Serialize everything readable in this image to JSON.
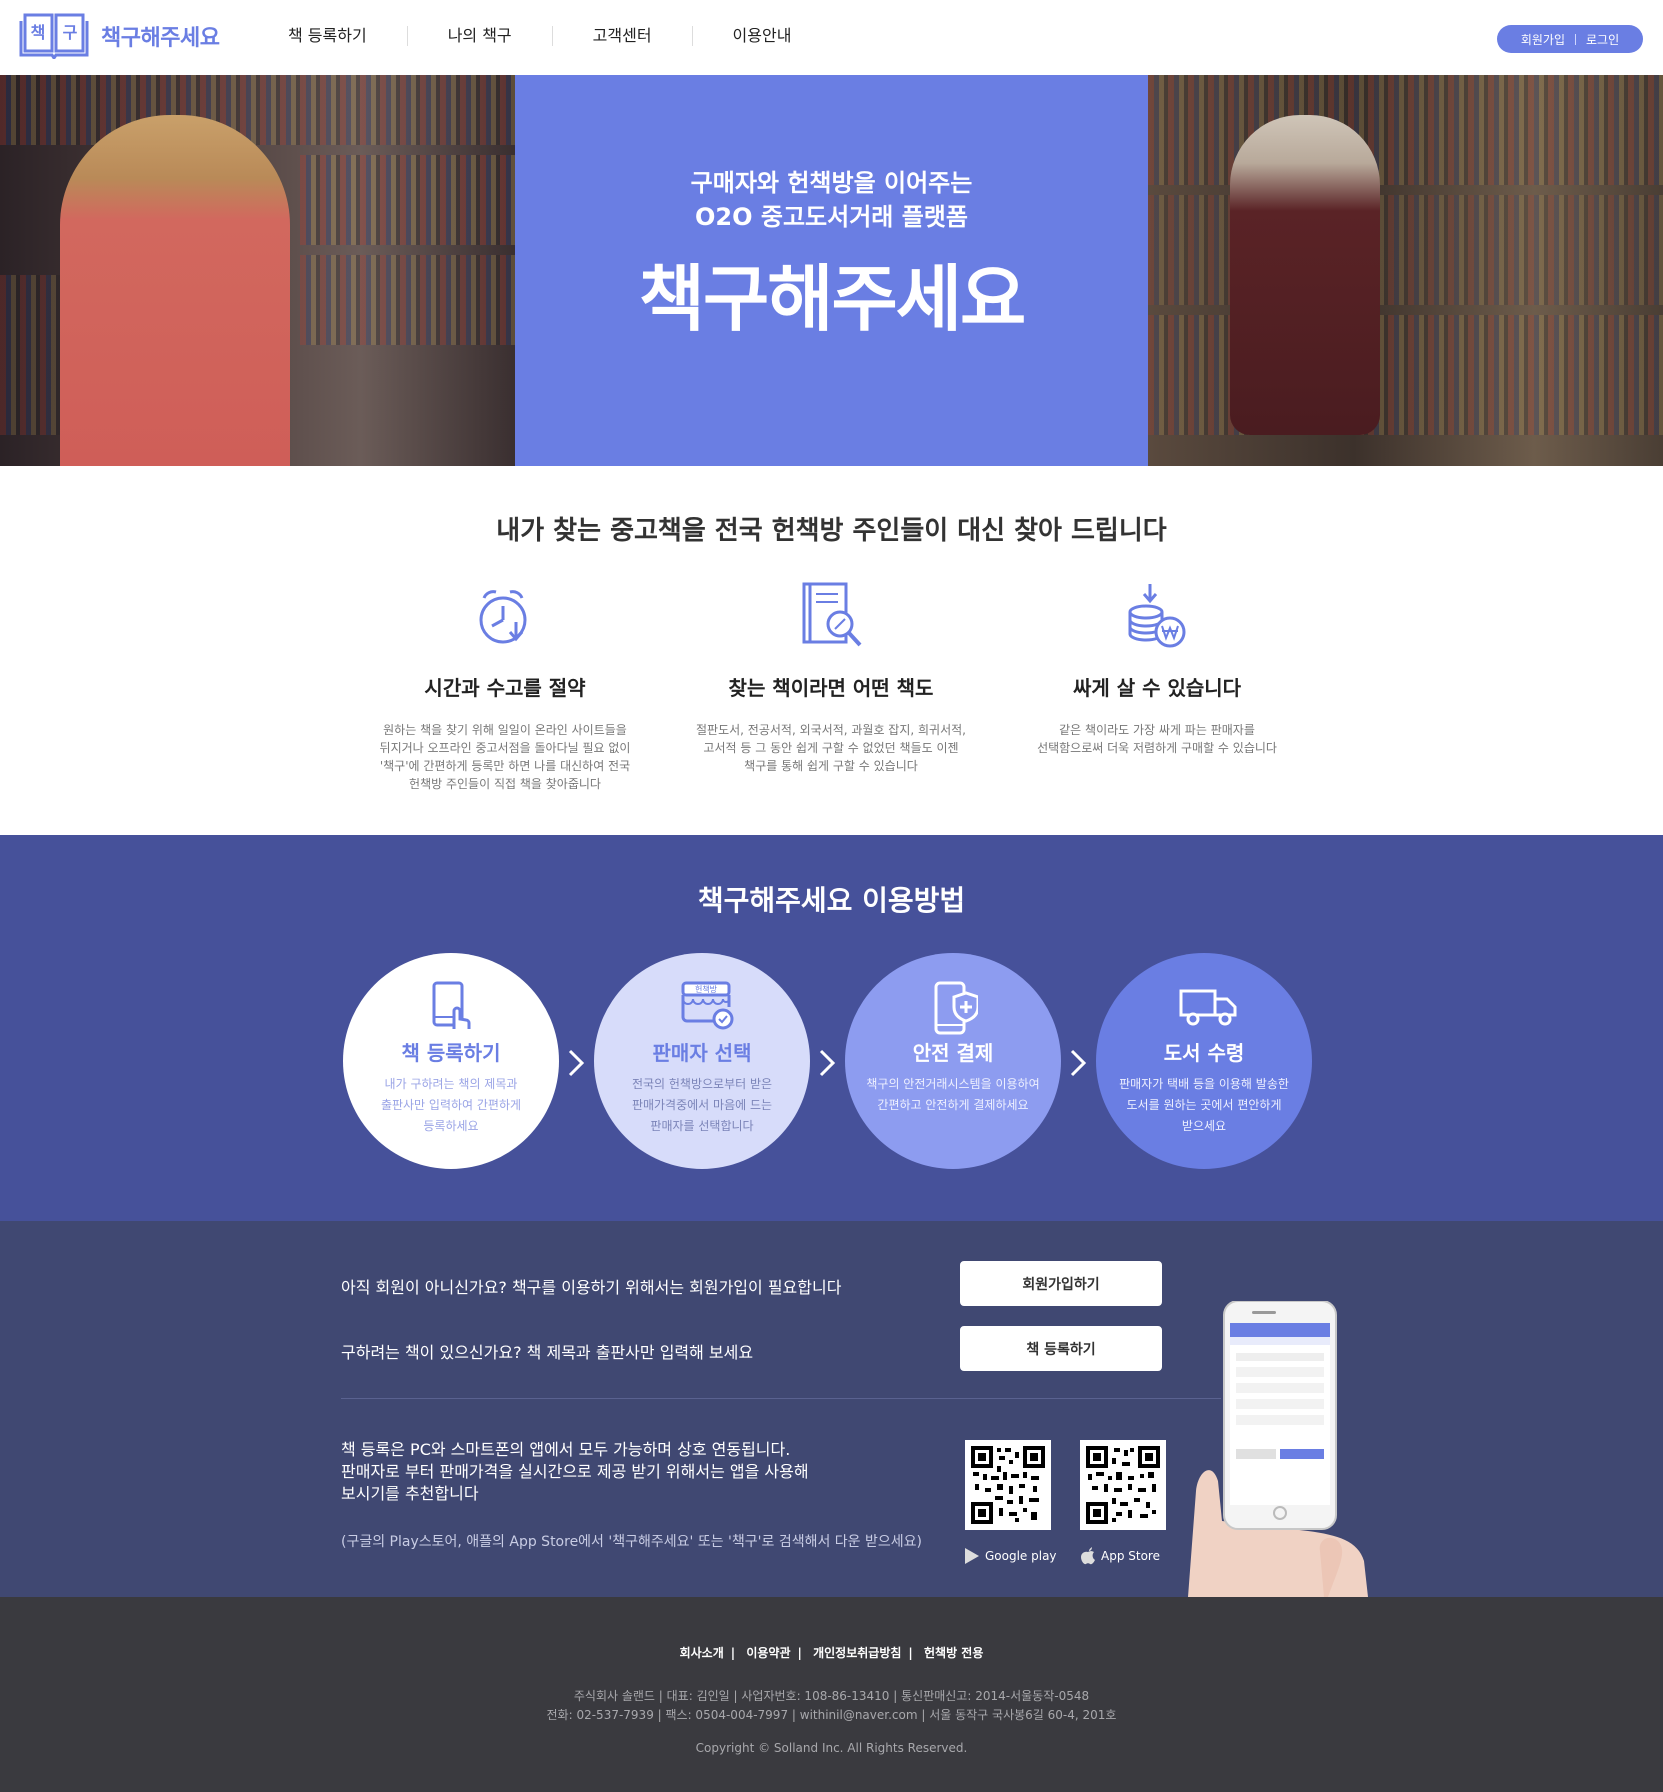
{
  "header": {
    "logo_mark": "책구",
    "logo_text": "책구해주세요",
    "nav": [
      "책 등록하기",
      "나의 책구",
      "고객센터",
      "이용안내"
    ],
    "signup": "회원가입",
    "login": "로그인"
  },
  "hero": {
    "sub_line1": "구매자와 헌책방을 이어주는",
    "sub_line2": "O2O 중고도서거래 플랫폼",
    "title": "책구해주세요"
  },
  "features": {
    "heading": "내가 찾는 중고책을 전국 헌책방 주인들이 대신 찾아 드립니다",
    "items": [
      {
        "icon": "alarm-clock-icon",
        "title": "시간과 수고를 절약",
        "desc_lines": [
          "원하는 책을 찾기 위해 일일이 온라인 사이트들을",
          "뒤지거나 오프라인 중고서점을 돌아다닐 필요 없이",
          "'책구'에 간편하게 등록만 하면 나를 대신하여 전국",
          "헌책방 주인들이 직접 책을 찾아줍니다"
        ]
      },
      {
        "icon": "book-search-icon",
        "title": "찾는 책이라면 어떤 책도",
        "desc_lines": [
          "절판도서, 전공서적, 외국서적, 과월호 잡지, 희귀서적,",
          "고서적 등 그 동안 쉽게 구할 수 없었던 책들도 이젠",
          "책구를 통해 쉽게 구할 수 있습니다"
        ]
      },
      {
        "icon": "coins-won-icon",
        "title": "싸게 살 수 있습니다",
        "desc_lines": [
          "같은 책이라도 가장 싸게 파는 판매자를",
          "선택함으로써 더욱 저렴하게 구매할 수 있습니다"
        ]
      }
    ]
  },
  "how": {
    "title": "책구해주세요 이용방법",
    "steps": [
      {
        "icon": "tablet-touch-icon",
        "title": "책 등록하기",
        "desc_lines": [
          "내가 구하려는 책의 제목과",
          "출판사만 입력하여 간편하게",
          "등록하세요"
        ]
      },
      {
        "icon": "bookstore-icon",
        "title": "판매자 선택",
        "desc_lines": [
          "전국의 헌책방으로부터 받은",
          "판매가격중에서 마음에 드는",
          "판매자를 선택합니다"
        ]
      },
      {
        "icon": "secure-payment-icon",
        "title": "안전 결제",
        "desc_lines": [
          "책구의 안전거래시스템을 이용하여",
          "간편하고 안전하게 결제하세요"
        ]
      },
      {
        "icon": "delivery-truck-icon",
        "title": "도서 수령",
        "desc_lines": [
          "판매자가 택배 등을 이용해 발송한",
          "도서를 원하는 곳에서 편안하게",
          "받으세요"
        ]
      }
    ],
    "colors": {
      "step1_bg": "#ffffff",
      "step2_bg": "#d7dcfa",
      "step3_bg": "#8d9cf0",
      "step4_bg": "#6a7ee3"
    }
  },
  "cta": {
    "line1": "아직 회원이 아니신가요? 책구를 이용하기 위해서는 회원가입이 필요합니다",
    "btn1": "회원가입하기",
    "line2": "구하려는 책이 있으신가요? 책 제목과 출판사만 입력해 보세요",
    "btn2": "책 등록하기",
    "app_lines": [
      "책 등록은 PC와 스마트폰의 앱에서 모두 가능하며 상호 연동됩니다.",
      "판매자로 부터 판매가격을 실시간으로 제공 받기 위해서는 앱을 사용해",
      "보시기를 추천합니다"
    ],
    "note": "(구글의 Play스토어, 애플의 App Store에서 '책구해주세요' 또는 '책구'로 검색해서 다운 받으세요)",
    "google_play": "Google play",
    "app_store": "App Store"
  },
  "footer": {
    "links": [
      "회사소개",
      "이용약관",
      "개인정보취급방침",
      "헌책방 전용"
    ],
    "info_line1": "주식회사 솔랜드 | 대표: 김인일 | 사업자번호: 108-86-13410 | 통신판매신고: 2014-서울동작-0548",
    "info_line2": "전화: 02-537-7939 | 팩스: 0504-004-7997 | withinil@naver.com | 서울 동작구 국사봉6길 60-4, 201호",
    "copyright": "Copyright © Solland Inc. All Rights Reserved."
  },
  "colors": {
    "accent": "#6a7ee3",
    "how_bg": "#46519a",
    "cta_bg": "#404872",
    "footer_bg": "#3a3a3f"
  }
}
